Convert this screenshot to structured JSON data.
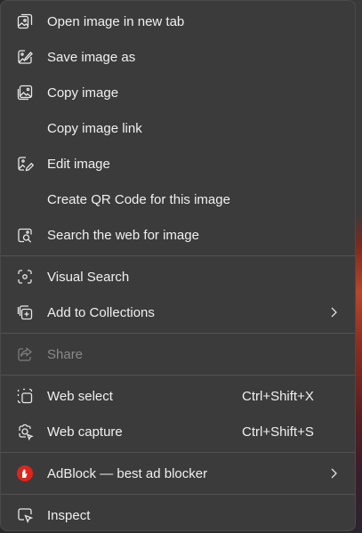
{
  "menu": {
    "items": [
      {
        "label": "Open image in new tab",
        "icon": "open-image-new-tab-icon"
      },
      {
        "label": "Save image as",
        "icon": "save-image-icon"
      },
      {
        "label": "Copy image",
        "icon": "copy-image-icon"
      },
      {
        "label": "Copy image link",
        "icon": ""
      },
      {
        "label": "Edit image",
        "icon": "edit-image-icon"
      },
      {
        "label": "Create QR Code for this image",
        "icon": ""
      },
      {
        "label": "Search the web for image",
        "icon": "search-image-icon"
      },
      {
        "label": "Visual Search",
        "icon": "visual-search-icon"
      },
      {
        "label": "Add to Collections",
        "icon": "collections-icon",
        "submenu": true
      },
      {
        "label": "Share",
        "icon": "share-icon",
        "disabled": true
      },
      {
        "label": "Web select",
        "icon": "web-select-icon",
        "shortcut": "Ctrl+Shift+X"
      },
      {
        "label": "Web capture",
        "icon": "web-capture-icon",
        "shortcut": "Ctrl+Shift+S"
      },
      {
        "label": "AdBlock — best ad blocker",
        "icon": "adblock-icon",
        "submenu": true
      },
      {
        "label": "Inspect",
        "icon": "inspect-icon"
      }
    ]
  },
  "colors": {
    "menu_bg": "#3b3b3b",
    "text": "#f0f0f0",
    "disabled_text": "#8a8a8a",
    "separator": "#525252",
    "adblock_red": "#e0241b"
  }
}
